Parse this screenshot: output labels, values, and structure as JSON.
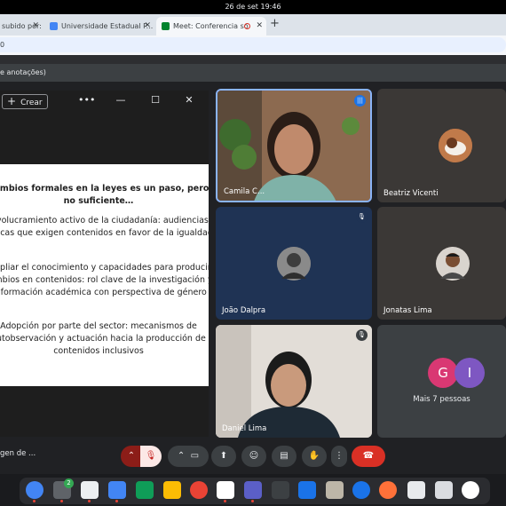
{
  "system": {
    "datetime": "26 de set  19:46"
  },
  "browser": {
    "tabs": [
      {
        "label": "subido por: Confe",
        "favicon": "document-icon"
      },
      {
        "label": "Universidade Estadual P...",
        "favicon": "university-icon"
      },
      {
        "label": "Meet: Conferencia so",
        "favicon": "meet-icon",
        "recording": true
      }
    ],
    "address": "0"
  },
  "notice": {
    "text": "e anotações)"
  },
  "presenter": {
    "create_label": "Crear",
    "slide": {
      "title": "Cambios formales en la leyes es un paso, pero no suficiente…",
      "points": [
        "Involucramiento activo de la ciudadanía: audiencias críticas que exigen contenidos en favor de la igualdad",
        "Ampliar el conocimiento y capacidades para producir cambios en contenidos:  rol clave de la investigación y la formación académica con perspectiva de género",
        "Adopción por parte del sector: mecanismos de autobservación y actuación hacia la producción de contenidos inclusivos"
      ]
    }
  },
  "participants": [
    {
      "name": "Camila C...",
      "kind": "video"
    },
    {
      "name": "Beatriz Vicenti",
      "kind": "avatar"
    },
    {
      "name": "João Dalpra",
      "kind": "avatar"
    },
    {
      "name": "Jonatas Lima",
      "kind": "avatar"
    },
    {
      "name": "Daniel Lima",
      "kind": "video"
    }
  ],
  "overflow": {
    "initials": [
      "G",
      "I"
    ],
    "label": "Mais 7 pessoas"
  },
  "bottom": {
    "meeting_title": "gen de ..."
  },
  "colors": {
    "accent": "#1a73e8",
    "danger": "#d93025",
    "tile_a": "#1f3354",
    "tile_b": "#3b3836"
  },
  "shelf": {
    "badge_count": "2",
    "apps": [
      "chrome-icon",
      "files-icon",
      "docs-icon",
      "slides-icon",
      "sheets-icon",
      "acrobat-icon",
      "gmail-icon",
      "calendar-icon",
      "teams-icon",
      "calculator-icon",
      "screenshot-icon",
      "text-editor-icon",
      "help-icon",
      "firefox-icon",
      "search-icon",
      "trash-icon",
      "settings-icon"
    ]
  }
}
